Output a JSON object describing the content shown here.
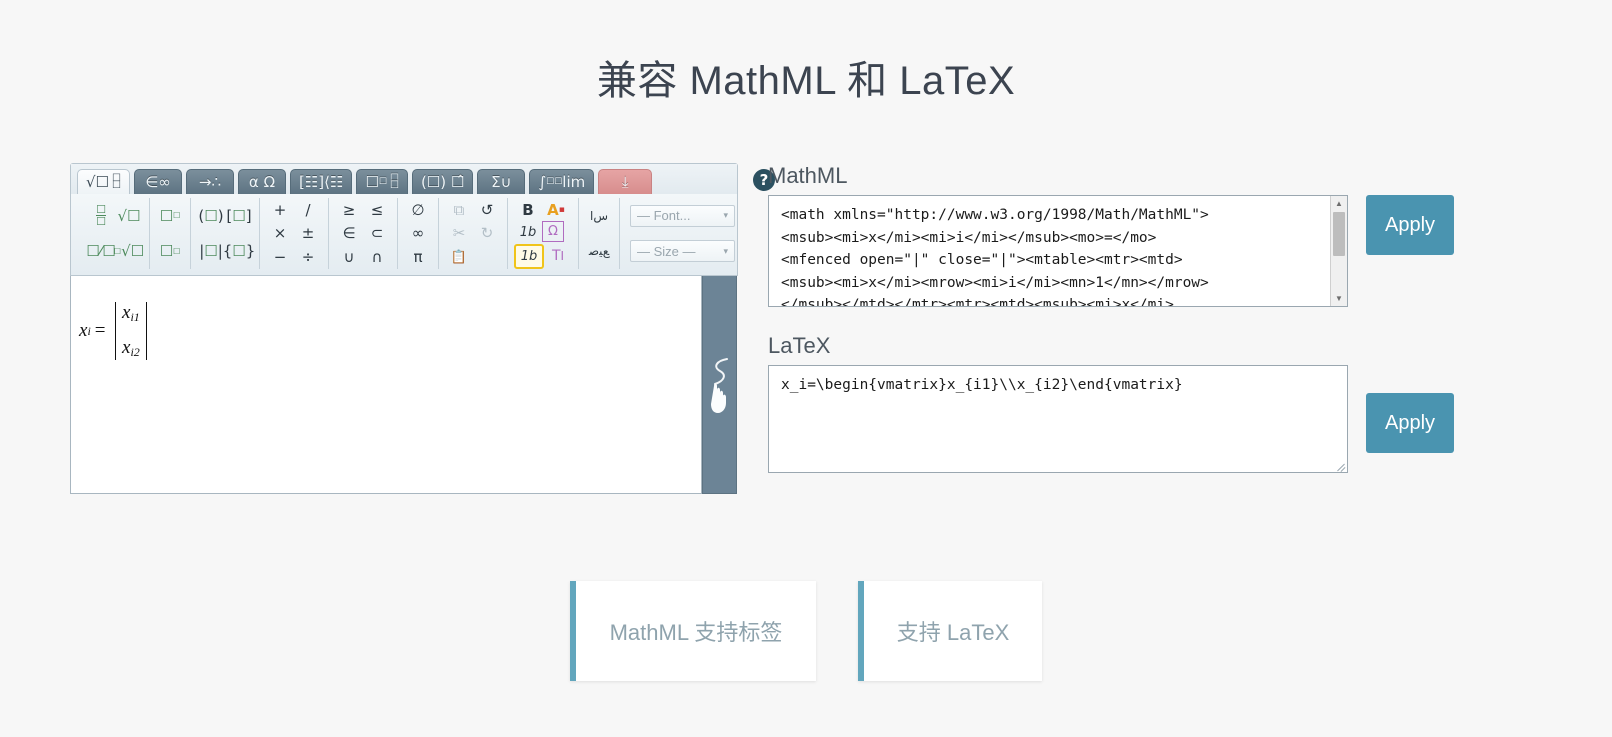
{
  "page": {
    "title": "兼容 MathML 和 LaTeX",
    "accent_color": "#4a94b0",
    "card_accent_color": "#62a6bd",
    "background_color": "#f7f7f7",
    "drag_bar_color": "#6c8496"
  },
  "editor": {
    "help_label": "?",
    "tabs": [
      {
        "id": "tab-basic",
        "label": "√☐ ☐/☐",
        "active": true,
        "style": "normal"
      },
      {
        "id": "tab-sets",
        "label": "∈ ∞",
        "active": false,
        "style": "normal"
      },
      {
        "id": "tab-arrows",
        "label": "→ ∴",
        "active": false,
        "style": "normal"
      },
      {
        "id": "tab-greek",
        "label": "α Ω",
        "active": false,
        "style": "normal"
      },
      {
        "id": "tab-matrix",
        "label": "[☐☐] {☐",
        "active": false,
        "style": "normal"
      },
      {
        "id": "tab-scripts",
        "label": "☐^☐ ☐",
        "active": false,
        "style": "normal"
      },
      {
        "id": "tab-decoration",
        "label": "(☐) ☐̂",
        "active": false,
        "style": "normal"
      },
      {
        "id": "tab-operators",
        "label": "Σ ∪",
        "active": false,
        "style": "normal"
      },
      {
        "id": "tab-calculus",
        "label": "∫ lim",
        "active": false,
        "style": "normal"
      },
      {
        "id": "tab-export",
        "label": "⤓",
        "active": false,
        "style": "red"
      }
    ],
    "button_groups": [
      {
        "id": "group-fractions-roots",
        "rows": [
          [
            {
              "id": "fraction-stacked",
              "glyph": "☐/☐",
              "color": "green"
            },
            {
              "id": "square-root",
              "glyph": "√☐",
              "color": "green"
            }
          ],
          [
            {
              "id": "fraction-slash",
              "glyph": "☐⁄☐",
              "color": "green"
            },
            {
              "id": "nth-root",
              "glyph": "ⁿ√☐",
              "color": "green"
            }
          ]
        ]
      },
      {
        "id": "group-scripts",
        "rows": [
          [
            {
              "id": "superscript",
              "glyph": "☐ᐟ",
              "color": "green"
            }
          ],
          [
            {
              "id": "subscript",
              "glyph": "☐ᵥ",
              "color": "green"
            }
          ]
        ]
      },
      {
        "id": "group-brackets",
        "rows": [
          [
            {
              "id": "parentheses",
              "glyph": "(☐)",
              "color": "green"
            },
            {
              "id": "square-bracket",
              "glyph": "[☐]",
              "color": "green"
            }
          ],
          [
            {
              "id": "absolute-value",
              "glyph": "|☐|",
              "color": "green"
            },
            {
              "id": "curly-bracket",
              "glyph": "{☐}",
              "color": "green"
            }
          ]
        ]
      },
      {
        "id": "group-operators",
        "rows": [
          [
            {
              "id": "plus",
              "glyph": "+",
              "color": "dark"
            },
            {
              "id": "slash",
              "glyph": "/",
              "color": "dark"
            }
          ],
          [
            {
              "id": "times",
              "glyph": "×",
              "color": "dark"
            },
            {
              "id": "plusminus",
              "glyph": "±",
              "color": "dark"
            }
          ],
          [
            {
              "id": "minus",
              "glyph": "−",
              "color": "dark"
            },
            {
              "id": "divide",
              "glyph": "÷",
              "color": "dark"
            }
          ]
        ]
      },
      {
        "id": "group-relations",
        "rows": [
          [
            {
              "id": "greater-equal",
              "glyph": "≥",
              "color": "dark"
            },
            {
              "id": "less-equal",
              "glyph": "≤",
              "color": "dark"
            }
          ],
          [
            {
              "id": "element-of",
              "glyph": "∈",
              "color": "dark"
            },
            {
              "id": "subset",
              "glyph": "⊂",
              "color": "dark"
            }
          ],
          [
            {
              "id": "union",
              "glyph": "∪",
              "color": "dark"
            },
            {
              "id": "intersection",
              "glyph": "∩",
              "color": "dark"
            }
          ]
        ]
      },
      {
        "id": "group-symbols",
        "rows": [
          [
            {
              "id": "empty-set",
              "glyph": "∅",
              "color": "dark"
            }
          ],
          [
            {
              "id": "infinity",
              "glyph": "∞",
              "color": "dark"
            }
          ],
          [
            {
              "id": "pi",
              "glyph": "π",
              "color": "dark"
            }
          ]
        ]
      },
      {
        "id": "group-clipboard",
        "rows": [
          [
            {
              "id": "copy-icon",
              "glyph": "⧉",
              "color": "dim"
            },
            {
              "id": "undo-icon",
              "glyph": "↺",
              "color": "dark"
            }
          ],
          [
            {
              "id": "cut-icon",
              "glyph": "✂",
              "color": "dim"
            },
            {
              "id": "redo-icon",
              "glyph": "↻",
              "color": "dim"
            }
          ],
          [
            {
              "id": "paste-icon",
              "glyph": "📋",
              "color": "dark"
            }
          ]
        ]
      },
      {
        "id": "group-format",
        "rows": [
          [
            {
              "id": "bold-button",
              "glyph": "B",
              "color": "bold"
            },
            {
              "id": "text-color-button",
              "glyph": "A",
              "color": "colorful"
            }
          ],
          [
            {
              "id": "italic-button",
              "glyph": "1b",
              "color": "ital"
            },
            {
              "id": "symbol-button",
              "glyph": "Ω",
              "color": "frame"
            }
          ],
          [
            {
              "id": "math-style-button",
              "glyph": "1b",
              "color": "boxed"
            },
            {
              "id": "text-style-button",
              "glyph": "TI",
              "color": "purple"
            }
          ]
        ]
      },
      {
        "id": "group-rtl",
        "rows": [
          [
            {
              "id": "arabic-ltr-icon",
              "glyph": "ﺱﺍ",
              "color": "dark"
            }
          ],
          [
            {
              "id": "arabic-rtl-icon",
              "glyph": "ﻊﻴﺻ",
              "color": "dark"
            }
          ]
        ]
      }
    ],
    "selects": [
      {
        "id": "font-select",
        "value": "— Font...  ",
        "caret": "▾"
      },
      {
        "id": "size-select",
        "value": "— Size —  ",
        "caret": "▾"
      }
    ],
    "formula": {
      "variable": "x",
      "variable_sub": "i",
      "equals": "=",
      "matrix_rows": [
        {
          "base": "x",
          "sub": "i1"
        },
        {
          "base": "x",
          "sub": "i2"
        }
      ]
    }
  },
  "mathml": {
    "label": "MathML",
    "value": "<math xmlns=\"http://www.w3.org/1998/Math/MathML\">\n<msub><mi>x</mi><mi>i</mi></msub><mo>=</mo>\n<mfenced open=\"|\" close=\"|\"><mtable><mtr><mtd>\n<msub><mi>x</mi><mrow><mi>i</mi><mn>1</mn></mrow>\n</msub></mtd></mtr><mtr><mtd><msub><mi>x</mi>",
    "apply_label": "Apply",
    "scroll_up": "▲",
    "scroll_down": "▼"
  },
  "latex": {
    "label": "LaTeX",
    "value": "x_i=\\begin{vmatrix}x_{i1}\\\\x_{i2}\\end{vmatrix}",
    "apply_label": "Apply"
  },
  "cards": [
    {
      "id": "card-mathml",
      "label": "MathML 支持标签"
    },
    {
      "id": "card-latex",
      "label": "支持 LaTeX"
    }
  ]
}
